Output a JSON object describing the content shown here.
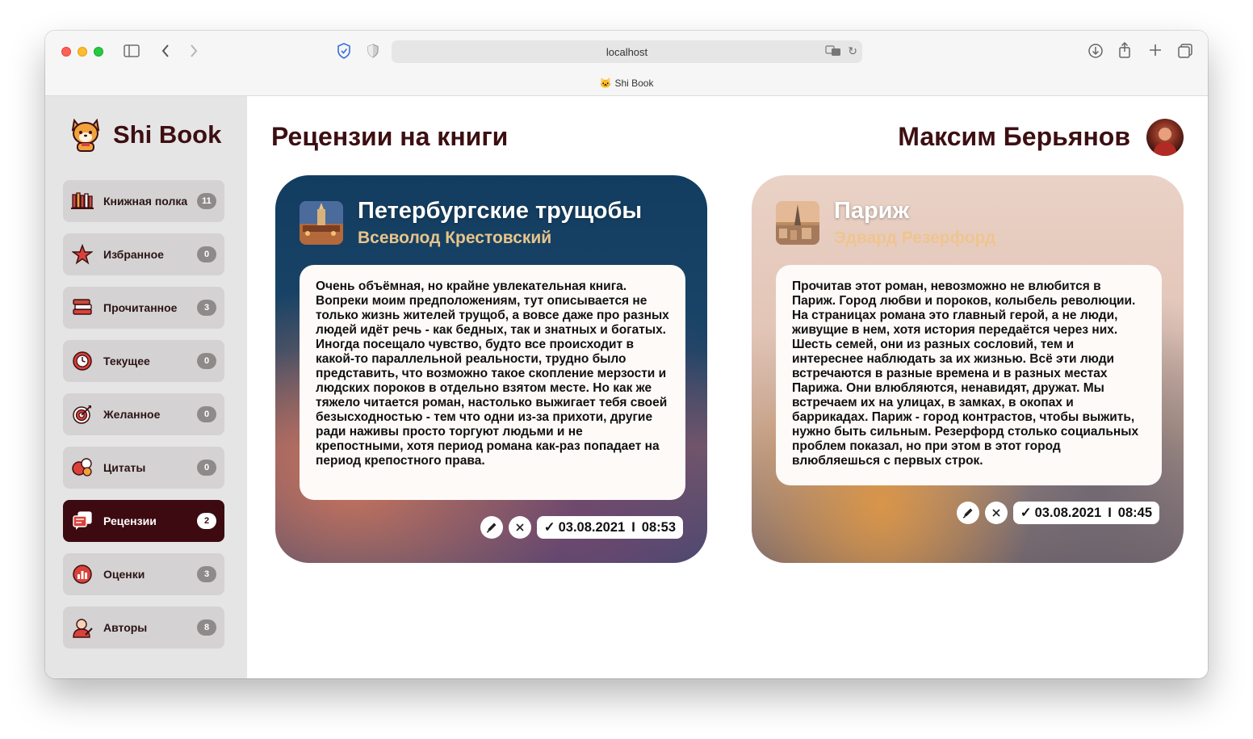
{
  "browser": {
    "url": "localhost",
    "tab_title": "Shi Book"
  },
  "app": {
    "name": "Shi Book"
  },
  "sidebar": {
    "items": [
      {
        "label": "Книжная полка",
        "count": "11",
        "icon": "bookshelf-icon"
      },
      {
        "label": "Избранное",
        "count": "0",
        "icon": "star-icon"
      },
      {
        "label": "Прочитанное",
        "count": "3",
        "icon": "book-stack-icon"
      },
      {
        "label": "Текущее",
        "count": "0",
        "icon": "clock-icon"
      },
      {
        "label": "Желанное",
        "count": "0",
        "icon": "target-icon"
      },
      {
        "label": "Цитаты",
        "count": "0",
        "icon": "quote-icon"
      },
      {
        "label": "Рецензии",
        "count": "2",
        "icon": "reviews-icon",
        "active": true
      },
      {
        "label": "Оценки",
        "count": "3",
        "icon": "ratings-icon"
      },
      {
        "label": "Авторы",
        "count": "8",
        "icon": "author-icon"
      }
    ]
  },
  "header": {
    "title": "Рецензии на книги",
    "user_name": "Максим Берьянов"
  },
  "reviews": [
    {
      "title": "Петербургские трущобы",
      "author": "Всеволод Крестовский",
      "text": "Очень объёмная, но крайне увлекательная книга. Вопреки моим предположениям, тут описывается не только жизнь жителей трущоб, а вовсе даже про разных людей идёт речь - как бедных, так и знатных и богатых. Иногда посещало чувство, будто все происходит в какой-то параллельной реальности, трудно было представить, что возможно такое скопление мерзости и людских пороков в отдельно взятом месте. Но как же тяжело читается роман, настолько выжигает тебя своей безысходностью - тем что одни из-за прихоти, другие ради наживы просто торгуют людьми и не крепостными, хотя период романа как-раз попадает на период крепостного права.",
      "check": "✓",
      "date": "03.08.2021",
      "separator": "I",
      "time": "08:53"
    },
    {
      "title": "Париж",
      "author": "Эдвард Резерфорд",
      "text": "Прочитав этот роман, невозможно не влюбится в Париж. Город любви и пороков, колыбель революции. На страницах романа это главный герой, а не люди, живущие в нем, хотя история передаётся через них. Шесть семей, они из разных сословий, тем и интереснее наблюдать за их жизнью. Всё эти люди встречаются в разные времена и в разных местах Парижа. Они влюбляются, ненавидят, дружат. Мы встречаем их на улицах, в замках, в окопах и баррикадах. Париж - город контрастов, чтобы выжить, нужно быть сильным. Резерфорд столько социальных проблем показал, но при этом в этот город влюбляешься с первых строк.",
      "check": "✓",
      "date": "03.08.2021",
      "separator": "I",
      "time": "08:45"
    }
  ]
}
